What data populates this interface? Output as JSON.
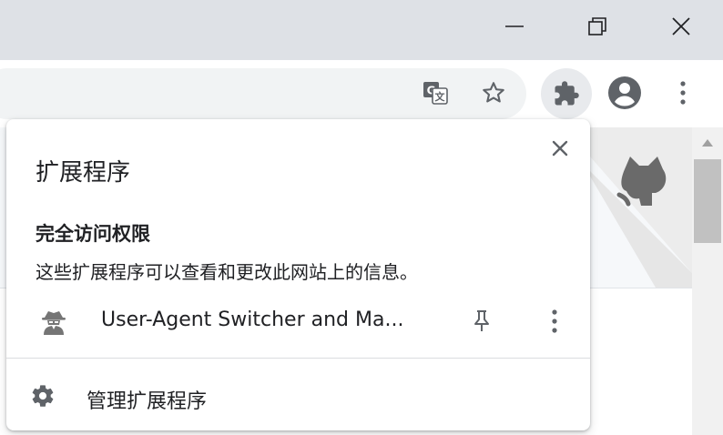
{
  "window": {
    "minimize_icon": "minimize-icon",
    "restore_icon": "restore-icon",
    "close_icon": "close-icon"
  },
  "toolbar": {
    "translate_icon": "translate-icon",
    "bookmark_icon": "star-icon",
    "extensions_icon": "puzzle-icon",
    "profile_icon": "account-icon",
    "menu_icon": "more-vertical-icon"
  },
  "colors": {
    "titlebar": "#dee1e6",
    "toolbar_icon": "#5f6368",
    "omnibox": "#f1f3f4",
    "divider": "#dadce0"
  },
  "popup": {
    "title": "扩展程序",
    "section_heading": "完全访问权限",
    "section_description": "这些扩展程序可以查看和更改此网站上的信息。",
    "extension": {
      "name": "User-Agent Switcher and Ma...",
      "icon": "spy-agent-icon",
      "pin_icon": "pin-icon",
      "more_icon": "more-vertical-icon"
    },
    "manage": {
      "label": "管理扩展程序",
      "icon": "gear-icon"
    }
  }
}
